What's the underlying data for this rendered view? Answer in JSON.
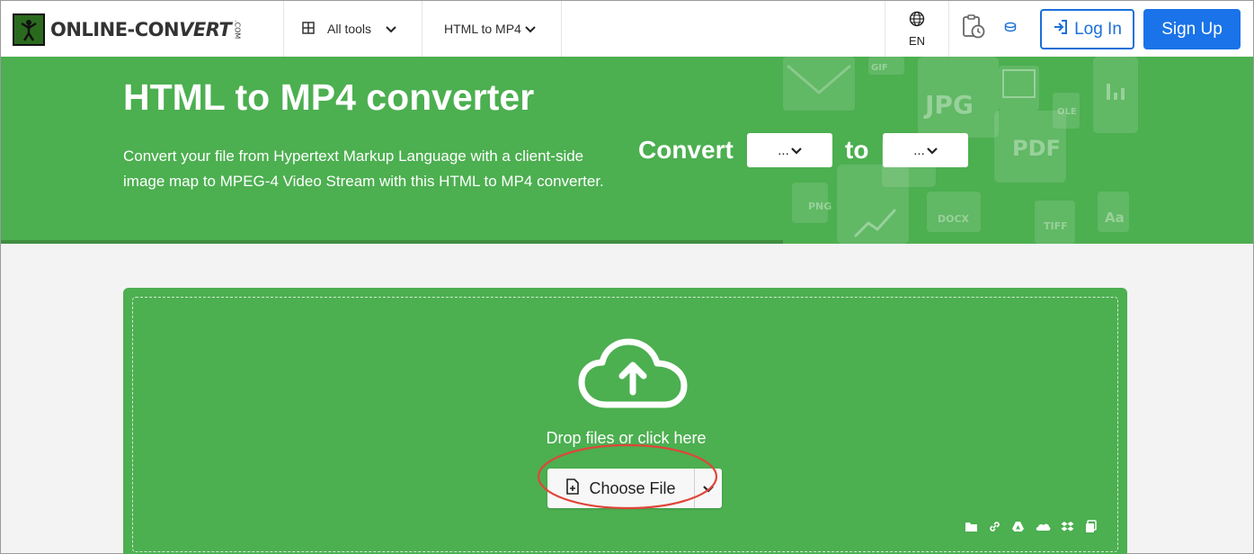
{
  "nav": {
    "logo_text_a": "ONLINE-CON",
    "logo_text_b": "VERT",
    "logo_dotcom": ".COM",
    "all_tools": "All tools",
    "current_tool": "HTML to MP4",
    "language": "EN",
    "login": "Log In",
    "signup": "Sign Up"
  },
  "hero": {
    "title": "HTML to MP4 converter",
    "description": "Convert your file from Hypertext Markup Language with a client-side image map to MPEG-4 Video Stream with this HTML to MP4 converter.",
    "convert_label": "Convert",
    "from_value": "...",
    "to_label": "to",
    "to_value": "...",
    "decor_formats": [
      "JPG",
      "PDF",
      "PNG",
      "DOCX",
      "TIFF",
      "GIF",
      "OLE",
      "Aa"
    ]
  },
  "upload": {
    "drop_text": "Drop files or click here",
    "choose_file": "Choose File",
    "sources": [
      "folder-icon",
      "link-icon",
      "google-drive-icon",
      "onedrive-icon",
      "dropbox-icon",
      "copy-icon"
    ]
  },
  "colors": {
    "green": "#4caf50",
    "primary_blue": "#1a73e8",
    "highlight_red": "#e0453a"
  }
}
